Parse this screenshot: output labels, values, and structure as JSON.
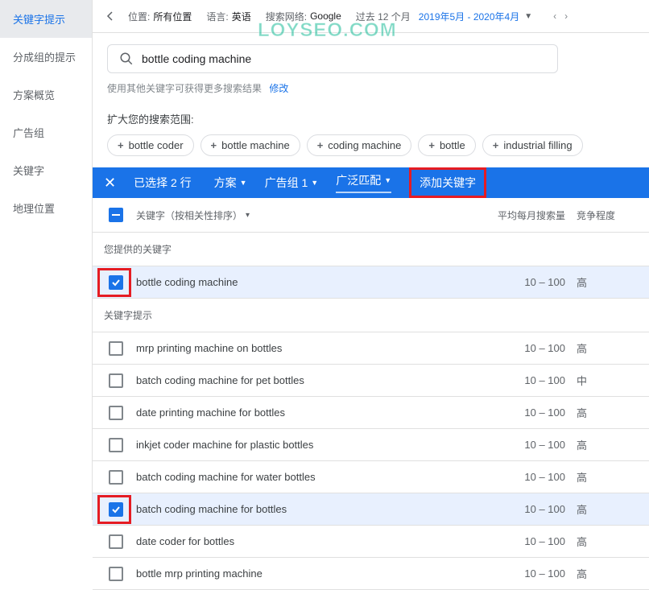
{
  "watermark": "LOYSEO.COM",
  "sidebar": {
    "items": [
      {
        "label": "关键字提示",
        "active": true
      },
      {
        "label": "分成组的提示",
        "active": false
      },
      {
        "label": "方案概览",
        "active": false
      },
      {
        "label": "广告组",
        "active": false
      },
      {
        "label": "关键字",
        "active": false
      },
      {
        "label": "地理位置",
        "active": false
      }
    ]
  },
  "topbar": {
    "location_label": "位置:",
    "location_value": "所有位置",
    "language_label": "语言:",
    "language_value": "英语",
    "network_label": "搜索网络:",
    "network_value": "Google",
    "period_label": "过去 12 个月",
    "date_range": "2019年5月 - 2020年4月"
  },
  "search": {
    "value": "bottle coding machine",
    "hint_text": "使用其他关键字可获得更多搜索结果",
    "hint_link": "修改"
  },
  "expand": {
    "label": "扩大您的搜索范围:",
    "pills": [
      "bottle coder",
      "bottle machine",
      "coding machine",
      "bottle",
      "industrial filling"
    ]
  },
  "bluebar": {
    "selected": "已选择 2 行",
    "plan": "方案",
    "adgroup": "广告组 1",
    "match": "广泛匹配",
    "add": "添加关键字"
  },
  "table": {
    "header_keyword": "关键字（按相关性排序）",
    "header_search": "平均每月搜索量",
    "header_comp": "竞争程度",
    "section_provided": "您提供的关键字",
    "section_ideas": "关键字提示",
    "provided": [
      {
        "kw": "bottle coding machine",
        "sv": "10 – 100",
        "comp": "高",
        "checked": true,
        "highlight": true
      }
    ],
    "ideas": [
      {
        "kw": "mrp printing machine on bottles",
        "sv": "10 – 100",
        "comp": "高",
        "checked": false,
        "highlight": false
      },
      {
        "kw": "batch coding machine for pet bottles",
        "sv": "10 – 100",
        "comp": "中",
        "checked": false,
        "highlight": false
      },
      {
        "kw": "date printing machine for bottles",
        "sv": "10 – 100",
        "comp": "高",
        "checked": false,
        "highlight": false
      },
      {
        "kw": "inkjet coder machine for plastic bottles",
        "sv": "10 – 100",
        "comp": "高",
        "checked": false,
        "highlight": false
      },
      {
        "kw": "batch coding machine for water bottles",
        "sv": "10 – 100",
        "comp": "高",
        "checked": false,
        "highlight": false
      },
      {
        "kw": "batch coding machine for bottles",
        "sv": "10 – 100",
        "comp": "高",
        "checked": true,
        "highlight": true
      },
      {
        "kw": "date coder for bottles",
        "sv": "10 – 100",
        "comp": "高",
        "checked": false,
        "highlight": false
      },
      {
        "kw": "bottle mrp printing machine",
        "sv": "10 – 100",
        "comp": "高",
        "checked": false,
        "highlight": false
      }
    ]
  }
}
